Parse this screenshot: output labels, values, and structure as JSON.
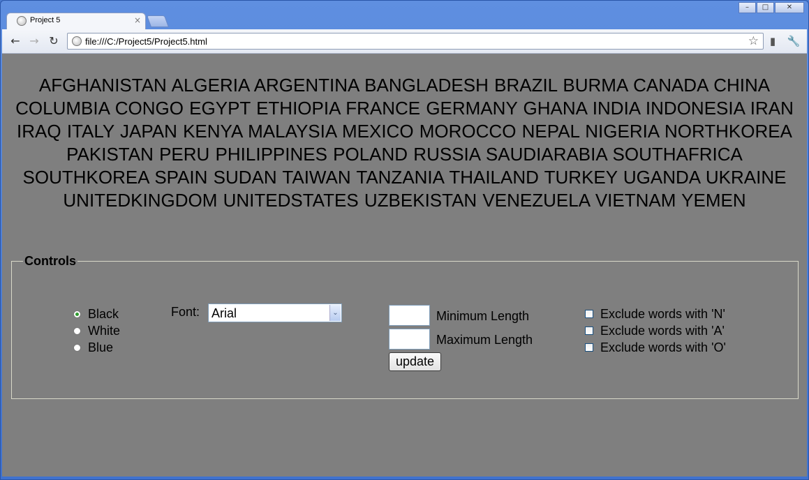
{
  "browser": {
    "tab_title": "Project 5",
    "url": "file:///C:/Project5/Project5.html",
    "tab_close": "×",
    "nav": {
      "back": "←",
      "forward": "→",
      "reload": "↻",
      "star": "☆",
      "page_menu": "▮",
      "wrench": "🔧"
    },
    "window_controls": {
      "minimize": "–",
      "maximize": "□",
      "close": "✕"
    }
  },
  "page": {
    "words_text": "AFGHANISTAN ALGERIA ARGENTINA BANGLADESH BRAZIL BURMA CANADA CHINA COLUMBIA CONGO EGYPT ETHIOPIA FRANCE GERMANY GHANA INDIA INDONESIA IRAN IRAQ ITALY JAPAN KENYA MALAYSIA MEXICO MOROCCO NEPAL NIGERIA NORTHKOREA PAKISTAN PERU PHILIPPINES POLAND RUSSIA SAUDIARABIA SOUTHAFRICA SOUTHKOREA SPAIN SUDAN TAIWAN TANZANIA THAILAND TURKEY UGANDA UKRAINE UNITEDKINGDOM UNITEDSTATES UZBEKISTAN VENEZUELA VIETNAM YEMEN",
    "controls": {
      "legend": "Controls",
      "color_options": [
        {
          "label": "Black",
          "checked": true
        },
        {
          "label": "White",
          "checked": false
        },
        {
          "label": "Blue",
          "checked": false
        }
      ],
      "font_label": "Font:",
      "font_selected": "Arial",
      "min_length_label": "Minimum Length",
      "min_length_value": "",
      "max_length_label": "Maximum Length",
      "max_length_value": "",
      "update_label": "update",
      "exclude_options": [
        {
          "label": "Exclude words with 'N'",
          "checked": false
        },
        {
          "label": "Exclude words with 'A'",
          "checked": false
        },
        {
          "label": "Exclude words with 'O'",
          "checked": false
        }
      ]
    }
  },
  "colors": {
    "page_background": "#7f7f7f",
    "fieldset_border": "#d8d8c8",
    "window_frame": "#3f72cf"
  }
}
